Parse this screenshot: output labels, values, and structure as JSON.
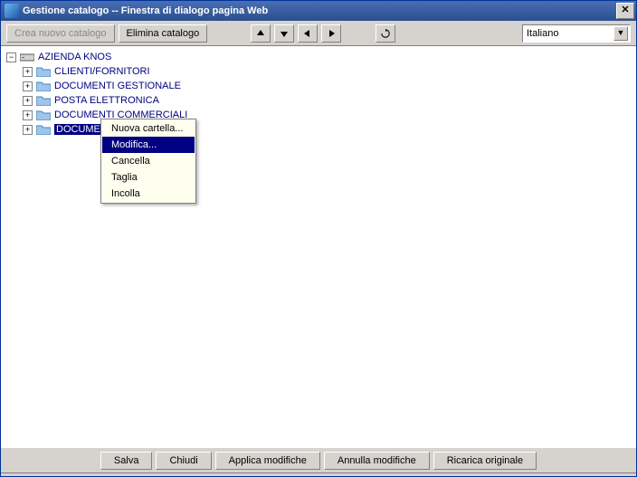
{
  "title": "Gestione catalogo -- Finestra di dialogo pagina Web",
  "toolbar": {
    "create_label": "Crea nuovo catalogo",
    "delete_label": "Elimina catalogo",
    "language": "Italiano"
  },
  "tree": {
    "root": "AZIENDA KNOS",
    "children": [
      "CLIENTI/FORNITORI",
      "DOCUMENTI GESTIONALE",
      "POSTA ELETTRONICA",
      "DOCUMENTI COMMERCIALI",
      "DOCUME"
    ]
  },
  "context_menu": {
    "items": [
      "Nuova cartella...",
      "Modifica...",
      "Cancella",
      "Taglia",
      "Incolla"
    ],
    "highlighted_index": 1
  },
  "bottom": {
    "save": "Salva",
    "close": "Chiudi",
    "apply": "Applica modifiche",
    "undo": "Annulla modifiche",
    "reload": "Ricarica originale"
  }
}
